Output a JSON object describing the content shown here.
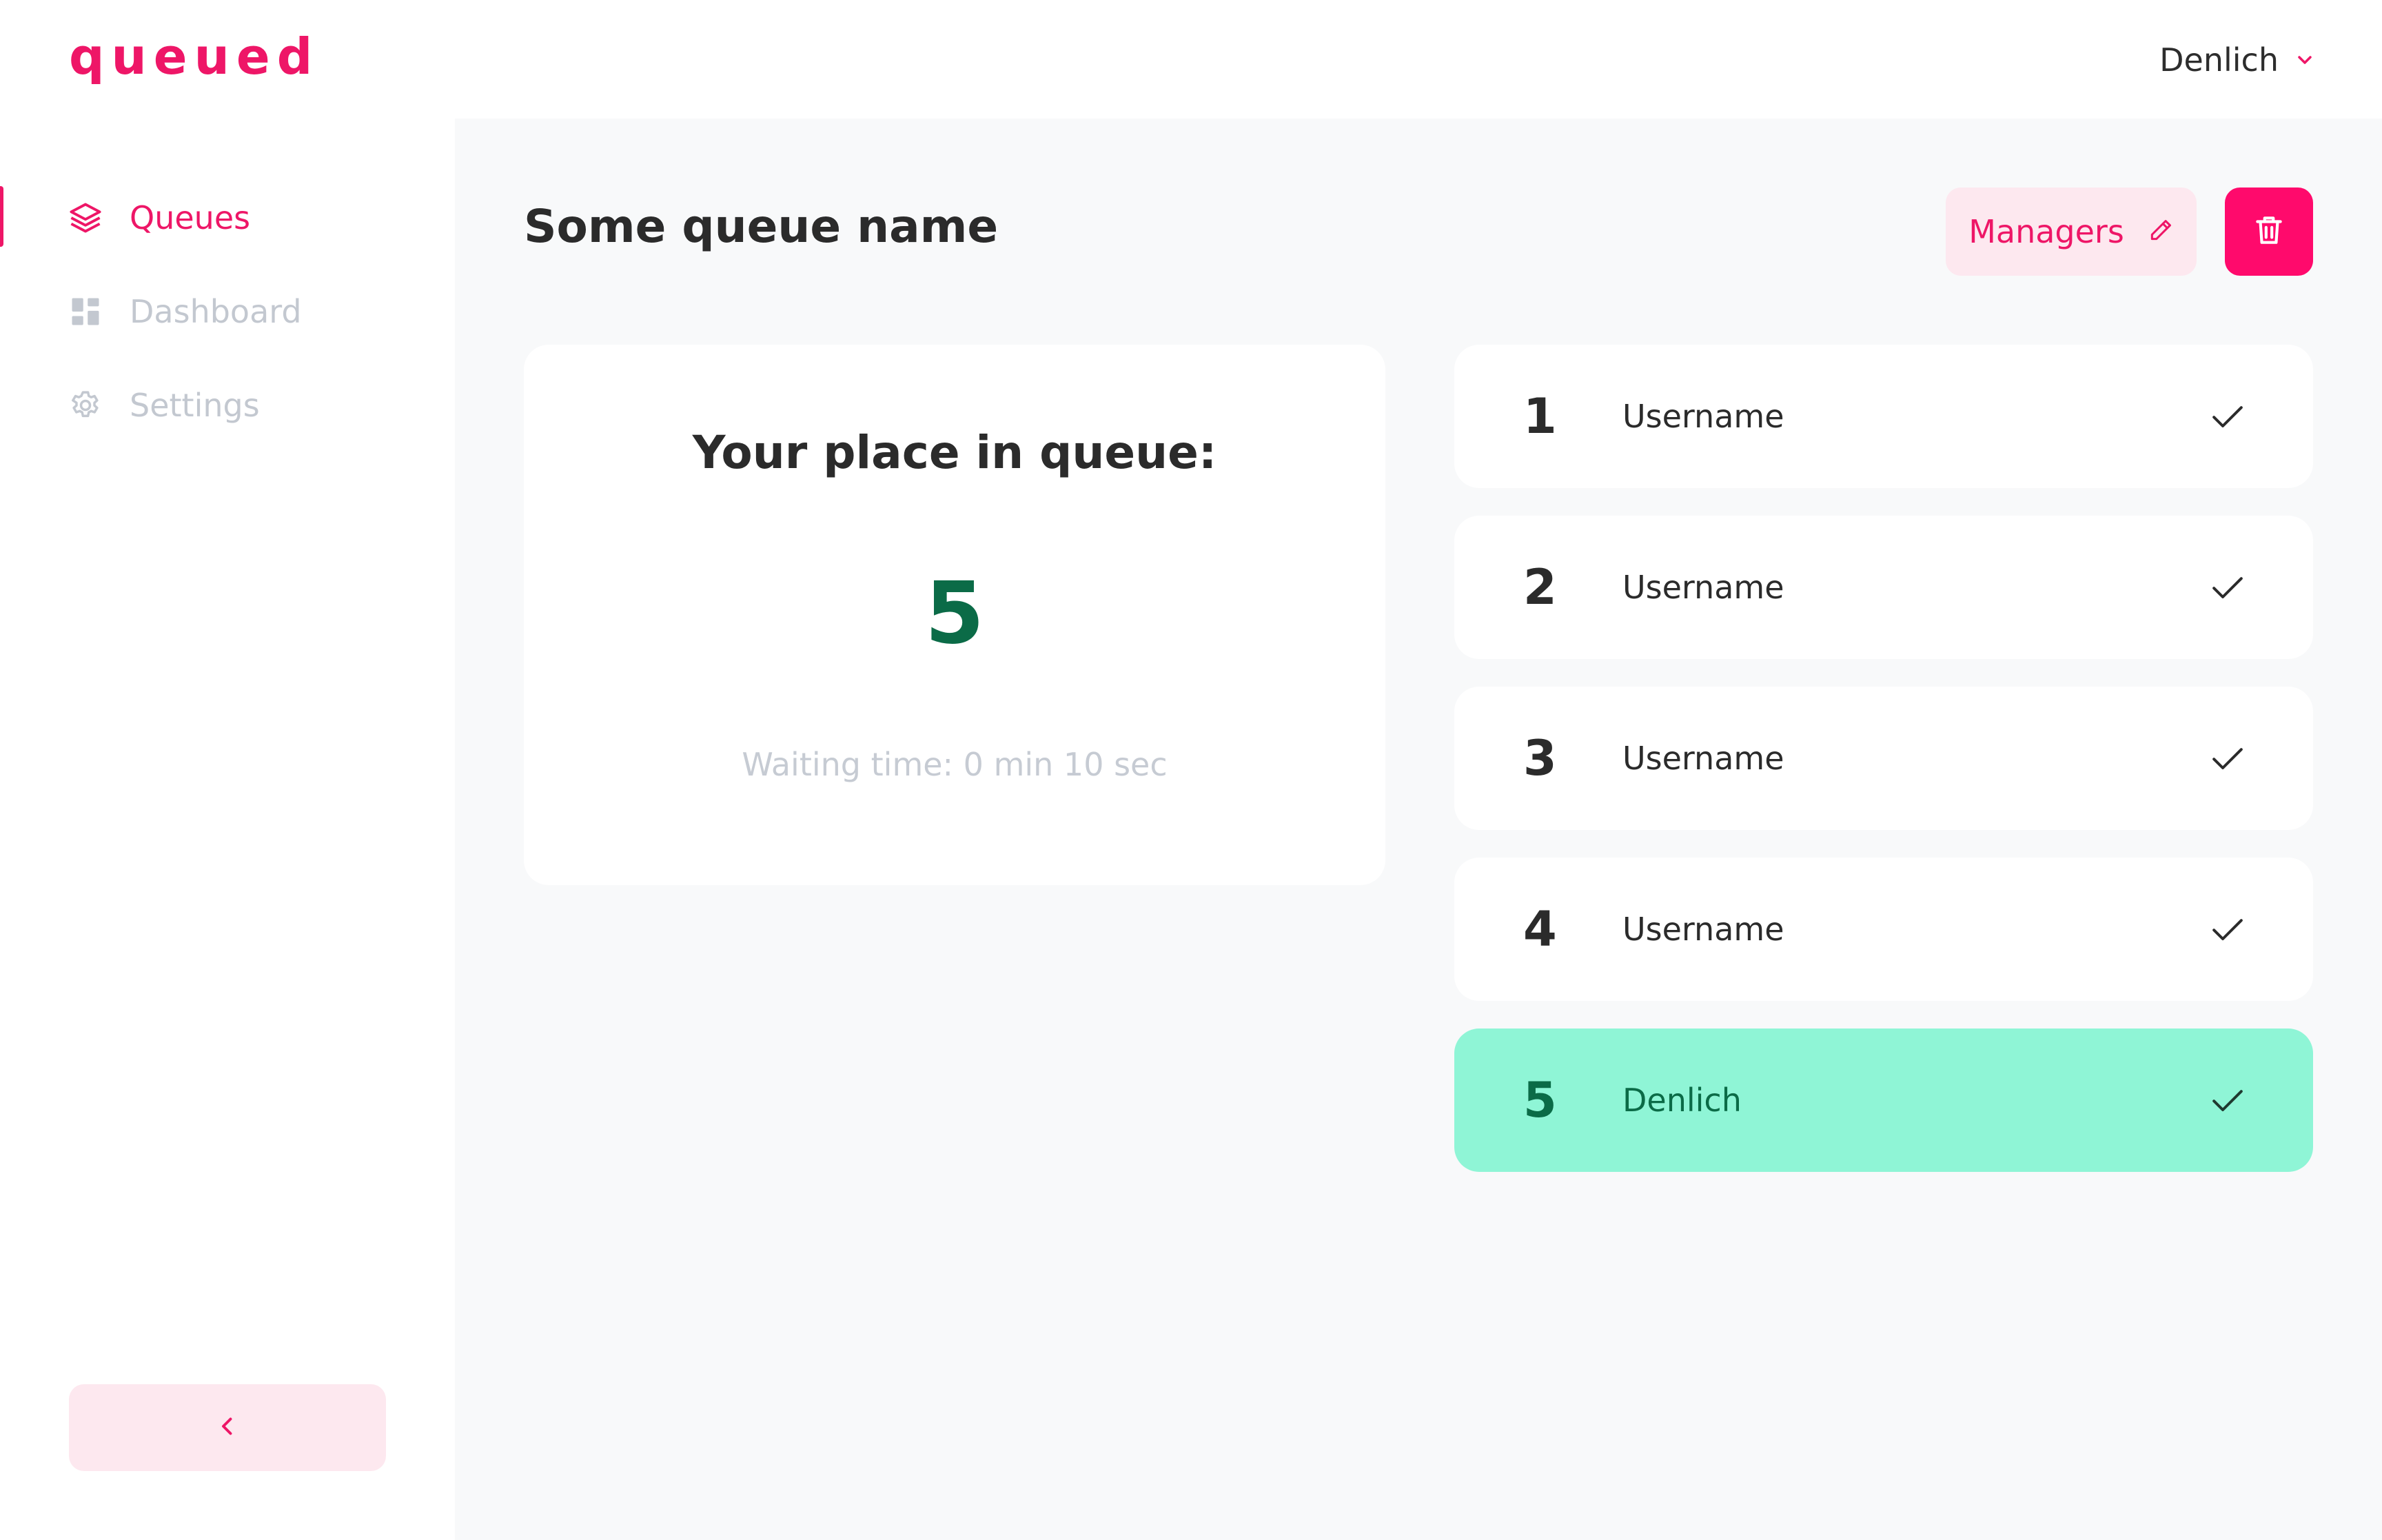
{
  "app": {
    "logo": "queued"
  },
  "user_menu": {
    "name": "Denlich",
    "icon": "chevron-down-icon"
  },
  "sidebar": {
    "items": [
      {
        "label": "Queues",
        "icon": "layers-icon",
        "active": true
      },
      {
        "label": "Dashboard",
        "icon": "grid-icon",
        "active": false
      },
      {
        "label": "Settings",
        "icon": "gear-icon",
        "active": false
      }
    ],
    "collapse_icon": "chevron-left-icon"
  },
  "page": {
    "title": "Some queue name",
    "managers_label": "Managers",
    "managers_icon": "pencil-icon",
    "delete_icon": "trash-icon"
  },
  "place_card": {
    "title": "Your place in queue:",
    "number": "5",
    "waiting_time": "Waiting time: 0 min 10 sec"
  },
  "queue": [
    {
      "position": "1",
      "name": "Username",
      "current": false
    },
    {
      "position": "2",
      "name": "Username",
      "current": false
    },
    {
      "position": "3",
      "name": "Username",
      "current": false
    },
    {
      "position": "4",
      "name": "Username",
      "current": false
    },
    {
      "position": "5",
      "name": "Denlich",
      "current": true
    }
  ],
  "colors": {
    "brand": "#ee1667",
    "delete": "#ff0a6c",
    "soft_pink": "#fde8ef",
    "current_row": "#8ff5d6",
    "current_text": "#0b6b47",
    "muted": "#c3c8d0",
    "background": "#f8f9fa"
  }
}
